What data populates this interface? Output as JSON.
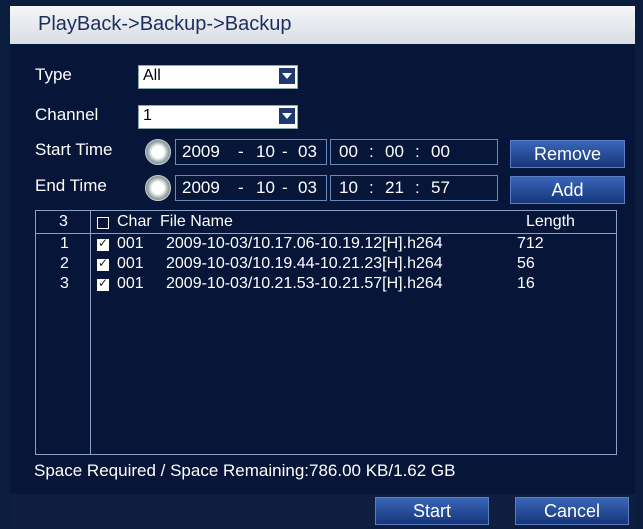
{
  "title": "PlayBack->Backup->Backup",
  "type": {
    "label": "Type",
    "value": "All"
  },
  "channel": {
    "label": "Channel",
    "value": "1"
  },
  "start_time": {
    "label": "Start Time",
    "year": "2009",
    "month": "10",
    "day": "03",
    "hh": "00",
    "mm": "00",
    "ss": "00"
  },
  "end_time": {
    "label": "End Time",
    "year": "2009",
    "month": "10",
    "day": "03",
    "hh": "10",
    "mm": "21",
    "ss": "57"
  },
  "buttons": {
    "remove": "Remove",
    "add": "Add",
    "start": "Start",
    "cancel": "Cancel"
  },
  "table": {
    "count": "3",
    "col_char": "Char",
    "col_file": "File Name",
    "col_length": "Length",
    "rows": [
      {
        "n": "1",
        "char": "001",
        "file": "2009-10-03/10.17.06-10.19.12[H].h264",
        "length": "712",
        "checked": true
      },
      {
        "n": "2",
        "char": "001",
        "file": "2009-10-03/10.19.44-10.21.23[H].h264",
        "length": "56",
        "checked": true
      },
      {
        "n": "3",
        "char": "001",
        "file": "2009-10-03/10.21.53-10.21.57[H].h264",
        "length": "16",
        "checked": true
      }
    ]
  },
  "space": "Space Required / Space Remaining:786.00 KB/1.62 GB",
  "colors": {
    "background": "#061538",
    "title_bar": "#e6e9ed",
    "button": "#234a96"
  }
}
